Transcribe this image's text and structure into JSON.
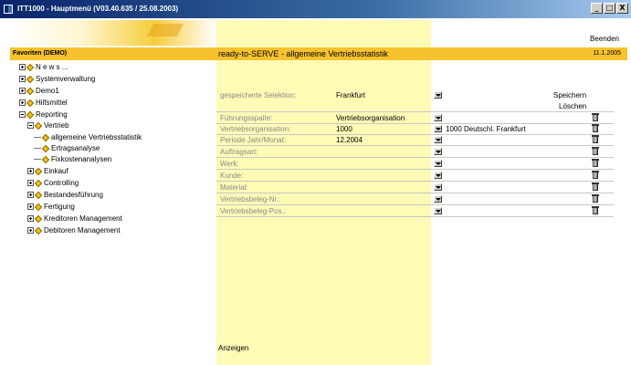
{
  "window": {
    "title": "ITT1000 - Hauptmenü (V03.40.635 / 25.08.2003)",
    "buttons": [
      "_",
      "□",
      "X"
    ]
  },
  "header": {
    "favorites": "Favoriten (DEMO)",
    "exit_label": "Beenden",
    "page_title": "ready-to-SERVE - allgemeine Vertriebsstatistik",
    "date": "11.1.2005"
  },
  "tree": [
    {
      "label": "N e w s ...",
      "type": "folder-plus",
      "indent": 0
    },
    {
      "label": "Systemverwaltung",
      "type": "folder-plus",
      "indent": 0
    },
    {
      "label": "Demo1",
      "type": "folder-plus",
      "indent": 0
    },
    {
      "label": "Hilfsmittel",
      "type": "folder-plus",
      "indent": 0
    },
    {
      "label": "Reporting",
      "type": "folder-minus",
      "indent": 0
    },
    {
      "label": "Vertrieb",
      "type": "folder-minus",
      "indent": 1
    },
    {
      "label": "allgemeine Vertriebsstatistik",
      "type": "leaf",
      "indent": 2
    },
    {
      "label": "Ertragsanalyse",
      "type": "leaf",
      "indent": 2
    },
    {
      "label": "Fixkostenanalysen",
      "type": "leaf",
      "indent": 2
    },
    {
      "label": "Einkauf",
      "type": "folder-plus",
      "indent": 1
    },
    {
      "label": "Controlling",
      "type": "folder-plus",
      "indent": 1
    },
    {
      "label": "Bestandesführung",
      "type": "folder-plus",
      "indent": 1
    },
    {
      "label": "Fertigung",
      "type": "folder-plus",
      "indent": 1
    },
    {
      "label": "Kreditoren Management",
      "type": "folder-plus",
      "indent": 1
    },
    {
      "label": "Debitoren Management",
      "type": "folder-plus",
      "indent": 1
    }
  ],
  "selection": {
    "label": "gespeicherte Selektion:",
    "value": "Frankfurt",
    "save_label": "Speichern",
    "delete_label": "Löschen"
  },
  "fields": [
    {
      "label": "Führungsspalte:",
      "value": "Vertriebsorganisation",
      "desc": ""
    },
    {
      "label": "Vertriebsorganisation:",
      "value": "1000",
      "desc": "1000 Deutschl. Frankfurt"
    },
    {
      "label": "Periode Jahr/Monat:",
      "value": "12.2004",
      "desc": ""
    },
    {
      "label": "Auftragsart:",
      "value": "",
      "desc": ""
    },
    {
      "label": "Werk:",
      "value": "",
      "desc": ""
    },
    {
      "label": "Kunde:",
      "value": "",
      "desc": ""
    },
    {
      "label": "Material:",
      "value": "",
      "desc": ""
    },
    {
      "label": "Vertriebsbeleg-Nr.:",
      "value": "",
      "desc": ""
    },
    {
      "label": "Vertriebsbeleg-Pos.:",
      "value": "",
      "desc": ""
    }
  ],
  "footer": {
    "show_label": "Anzeigen"
  }
}
